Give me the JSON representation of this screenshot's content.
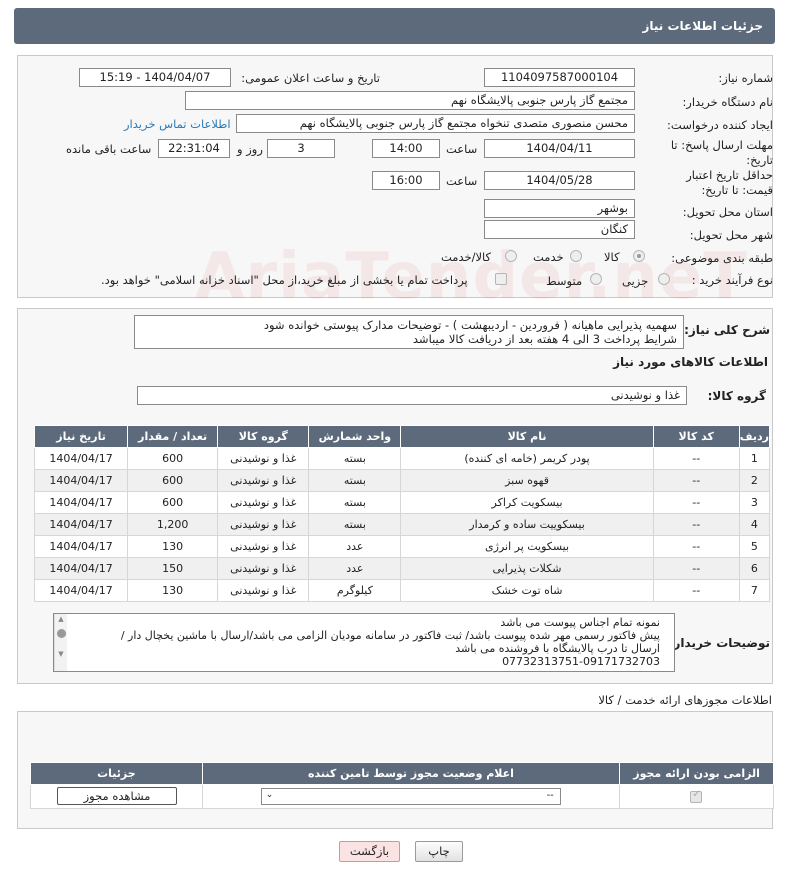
{
  "header": {
    "title": "جزئیات اطلاعات نیاز"
  },
  "form": {
    "need_number_label": "شماره نیاز:",
    "need_number": "1104097587000104",
    "announce_label": "تاریخ و ساعت اعلان عمومی:",
    "announce_value": "1404/04/07 - 15:19",
    "buyer_org_label": "نام دستگاه خریدار:",
    "buyer_org": "مجتمع گاز پارس جنوبی  پالایشگاه نهم",
    "requester_label": "ایجاد کننده درخواست:",
    "requester": "محسن منصوری متصدی تنخواه مجتمع گاز پارس جنوبی  پالایشگاه نهم",
    "buyer_contact_link": "اطلاعات تماس خریدار",
    "reply_deadline_label": "مهلت ارسال پاسخ: تا تاریخ:",
    "reply_date": "1404/04/11",
    "time_label": "ساعت",
    "reply_time": "14:00",
    "days_count": "3",
    "days_and_label": "روز و",
    "remaining_time": "22:31:04",
    "remaining_label": "ساعت باقی مانده",
    "price_validity_label": "حداقل تاریخ اعتبار قیمت: تا تاریخ:",
    "price_date": "1404/05/28",
    "price_time": "16:00",
    "province_label": "استان محل تحویل:",
    "province": "بوشهر",
    "city_label": "شهر محل تحویل:",
    "city": "کنگان",
    "category_label": "طبقه بندی موضوعی:",
    "category_options": [
      "کالا",
      "خدمت",
      "کالا/خدمت"
    ],
    "process_label": "نوع فرآیند خرید :",
    "process_options": [
      "جزیی",
      "متوسط"
    ],
    "payment_note": "پرداخت تمام یا بخشی از مبلغ خرید،از محل \"اسناد خزانه اسلامی\" خواهد بود."
  },
  "description": {
    "label": "شرح کلی نیاز:",
    "text_line1": "سهمیه پذیرایی ماهیانه ( فروردین - اردیبهشت ) - توضیحات مدارک پیوستی خوانده شود",
    "text_line2": "شرایط پرداخت 3 الی 4 هفته بعد از دریافت کالا میباشد"
  },
  "goods_section": {
    "title": "اطلاعات کالاهای مورد نیاز",
    "group_label": "گروه کالا:",
    "group_value": "غذا و نوشیدنی"
  },
  "items_table": {
    "headers": [
      "ردیف",
      "کد کالا",
      "نام کالا",
      "واحد شمارش",
      "گروه کالا",
      "تعداد / مقدار",
      "تاریخ نیاز"
    ],
    "rows": [
      [
        "1",
        "--",
        "پودر کریمر (خامه ای کننده)",
        "بسته",
        "غذا و نوشیدنی",
        "600",
        "1404/04/17"
      ],
      [
        "2",
        "--",
        "قهوه سبز",
        "بسته",
        "غذا و نوشیدنی",
        "600",
        "1404/04/17"
      ],
      [
        "3",
        "--",
        "بیسکویت کراکر",
        "بسته",
        "غذا و نوشیدنی",
        "600",
        "1404/04/17"
      ],
      [
        "4",
        "--",
        "بیسکوییت ساده و کرمدار",
        "بسته",
        "غذا و نوشیدنی",
        "1,200",
        "1404/04/17"
      ],
      [
        "5",
        "--",
        "بیسکویت پر انرژی",
        "عدد",
        "غذا و نوشیدنی",
        "130",
        "1404/04/17"
      ],
      [
        "6",
        "--",
        "شکلات پذیرایی",
        "عدد",
        "غذا و نوشیدنی",
        "150",
        "1404/04/17"
      ],
      [
        "7",
        "--",
        "شاه توت خشک",
        "کیلوگرم",
        "غذا و نوشیدنی",
        "130",
        "1404/04/17"
      ]
    ]
  },
  "buyer_notes": {
    "label": "توضیحات خریدار:",
    "line1": "نمونه تمام اجناس پیوست می باشد",
    "line2": "پیش فاکتور رسمی مهر شده پیوست باشد/ ثبت فاکتور در سامانه مودیان الزامی می باشد/ارسال با ماشین یخچال دار /",
    "line3": "ارسال تا درب پالایشگاه با فروشنده می باشد",
    "line4": "07732313751-09171732703"
  },
  "licenses": {
    "title": "اطلاعات مجوزهای ارائه خدمت / کالا",
    "headers": [
      "الزامی بودن ارائه مجوز",
      "اعلام وضعیت مجوز توسط تامین کننده",
      "جزئیات"
    ],
    "status_select": "--",
    "view_button": "مشاهده مجوز"
  },
  "footer": {
    "print_button": "چاپ",
    "back_button": "بازگشت"
  },
  "colors": {
    "header_bg": "#5c6a7c",
    "link": "#2a7ab8",
    "back_button_bg": "#fbe3e3"
  }
}
